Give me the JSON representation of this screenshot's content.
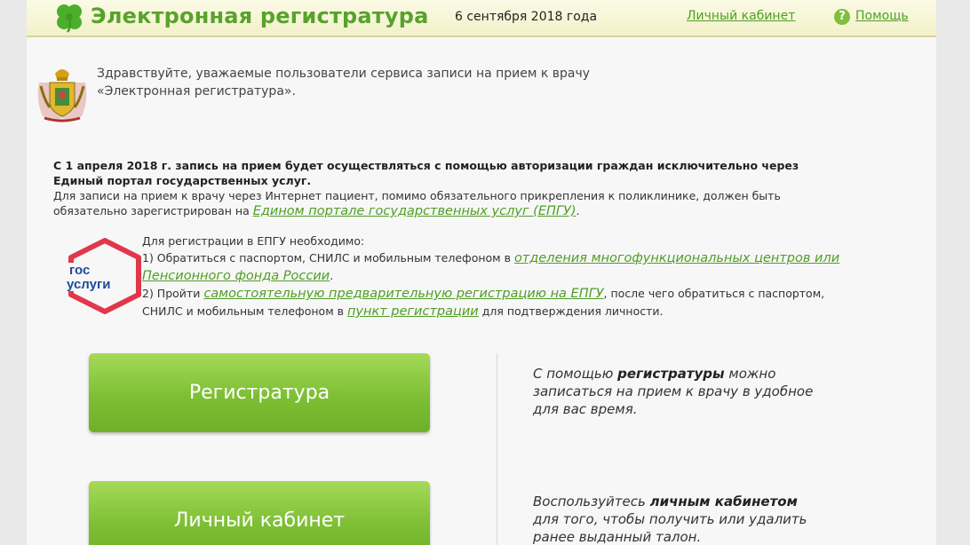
{
  "header": {
    "title": "Электронная регистратура",
    "date": "6 сентября 2018 года",
    "cabinet_link": "Личный кабинет",
    "help_link": "Помощь",
    "help_icon_glyph": "?"
  },
  "greeting": {
    "line1": "Здравствуйте, уважаемые пользователи сервиса записи на прием к врачу",
    "line2": "«Электронная регистратура»."
  },
  "notice": {
    "bold": "С 1 апреля 2018 г. запись на прием будет осуществляться с помощью авторизации граждан исключительно через Единый портал государственных услуг.",
    "text": "Для записи на прием к врачу через Интернет пациент, помимо обязательного прикрепления к поликлинике, должен быть обязательно зарегистрирован на",
    "link": "Едином портале государственных услуг (ЕПГУ)",
    "tail": "."
  },
  "gosuslugi_logo": {
    "line1": "гос",
    "line2": "услуги"
  },
  "registration": {
    "intro": "Для регистрации в ЕПГУ необходимо:",
    "step1_text": "1) Обратиться с паспортом, СНИЛС и мобильным телефоном в",
    "step1_link": "отделения многофункциональных центров или Пенсионного фонда России",
    "step1_tail": ".",
    "step2_text": "2) Пройти",
    "step2_link": "самостоятельную предварительную регистрацию на ЕПГУ",
    "step2_mid": ", после чего обратиться с паспортом, СНИЛС и мобильным телефоном в",
    "step2_link2": "пункт регистрации",
    "step2_tail": "для подтверждения личности."
  },
  "actions": {
    "registry_button": "Регистратура",
    "registry_desc_pre": "С помощью",
    "registry_desc_bold": "регистратуры",
    "registry_desc_post": "можно записаться на прием к врачу в удобное для вас время.",
    "cabinet_button": "Личный кабинет",
    "cabinet_desc_pre": "Воспользуйтесь",
    "cabinet_desc_bold": "личным кабинетом",
    "cabinet_desc_post": "для того, чтобы получить или удалить ранее выданный талон."
  },
  "colors": {
    "accent_green": "#58a22c",
    "link_green": "#4f9e24",
    "button_green": "#7dbf34",
    "header_bg": "#f2f1c9",
    "gosuslugi_blue": "#1e4a9c",
    "gosuslugi_red": "#e0384a"
  },
  "icons": {
    "logo": "clover-icon",
    "help": "help-icon",
    "emblem": "coat-of-arms-icon",
    "gosuslugi": "gosuslugi-logo"
  }
}
